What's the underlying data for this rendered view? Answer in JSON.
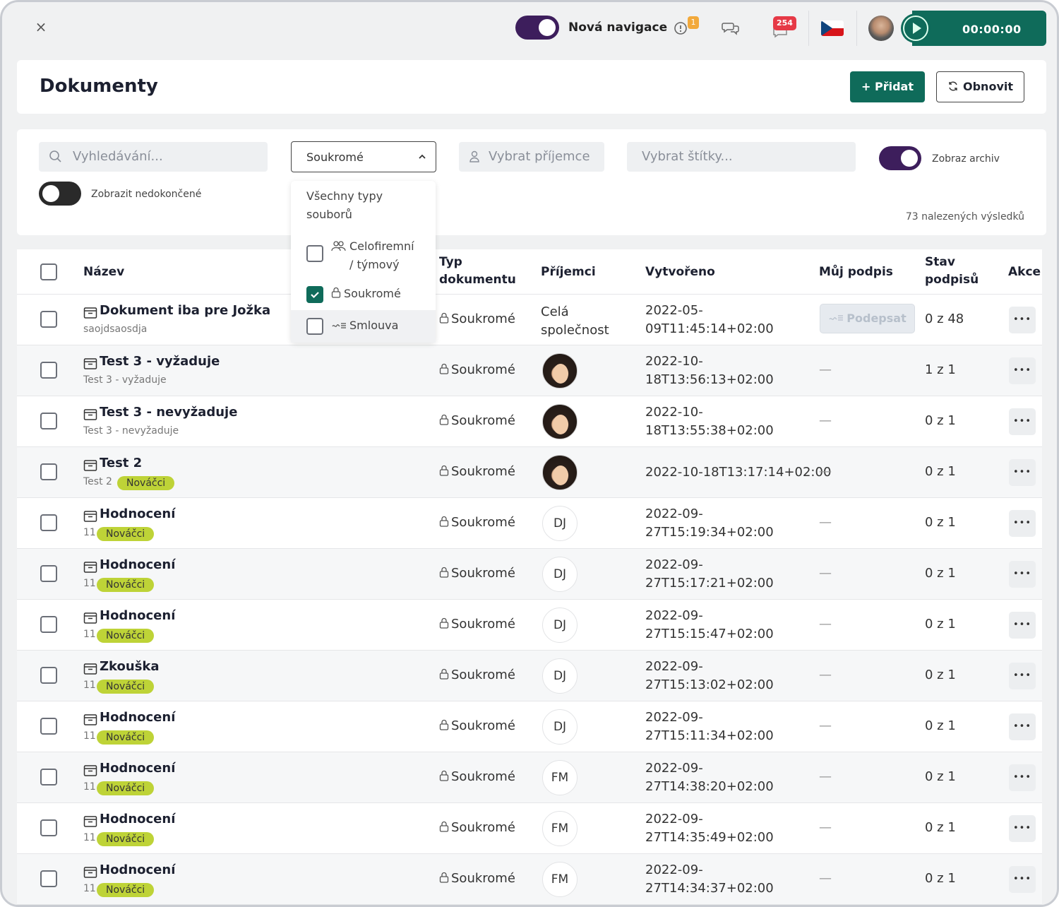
{
  "topbar": {
    "close_icon": "×",
    "nav_toggle_label": "Nová navigace",
    "notification_count": "1",
    "message_count": "254",
    "language": "CZ",
    "timer": "00:00:00"
  },
  "header": {
    "title": "Dokumenty",
    "add_label": "+ Přidat",
    "refresh_label": "Obnovit"
  },
  "filters": {
    "search_placeholder": "Vyhledávání...",
    "type_select_value": "Soukromé",
    "recipient_placeholder": "Vybrat příjemce",
    "tags_placeholder": "Vybrat štítky...",
    "archive_toggle_label": "Zobraz archiv",
    "archive_toggle_on": true,
    "unfinished_toggle_label": "Zobrazit nedokončené",
    "unfinished_toggle_on": false,
    "results_count": "73 nalezených výsledků"
  },
  "type_menu": {
    "all_types_line1": "Všechny typy",
    "all_types_line2": "souborů",
    "options": [
      {
        "label_line1": "Celofiremní",
        "label_line2": "/ týmový",
        "icon": "users-icon",
        "checked": false
      },
      {
        "label": "Soukromé",
        "icon": "lock-icon",
        "checked": true
      },
      {
        "label": "Smlouva",
        "icon": "contract-icon",
        "checked": false
      }
    ]
  },
  "table": {
    "headers": {
      "name": "Název",
      "type_line1": "Typ",
      "type_line2": "dokumentu",
      "recipients": "Příjemci",
      "created": "Vytvořeno",
      "my_signature": "Můj podpis",
      "status_line1": "Stav",
      "status_line2": "podpisů",
      "actions": "Akce"
    },
    "rows": [
      {
        "title": "Dokument iba pre Jožka",
        "subtitle": "saojdsaosdja",
        "tag": "",
        "type": "Soukromé",
        "recipient_line1": "Celá",
        "recipient_line2": "společnost",
        "created_line1": "2022-05-",
        "created_line2": "09T11:45:14+02:00",
        "my_sign": "Podepsat",
        "status": "0 z 48",
        "actions": "•••"
      },
      {
        "title": "Test 3 - vyžaduje",
        "subtitle": "Test 3 - vyžaduje",
        "tag": "",
        "type": "Soukromé",
        "recipient_avatar": "photo-avatar",
        "created_line1": "2022-10-",
        "created_line2": "18T13:56:13+02:00",
        "my_sign": "—",
        "status": "1 z 1",
        "actions": "•••"
      },
      {
        "title": "Test 3 - nevyžaduje",
        "subtitle": "Test 3 - nevyžaduje",
        "tag": "",
        "type": "Soukromé",
        "recipient_avatar": "photo-avatar",
        "created_line1": "2022-10-",
        "created_line2": "18T13:55:38+02:00",
        "my_sign": "—",
        "status": "0 z 1",
        "actions": "•••"
      },
      {
        "title": "Test 2",
        "subtitle": "Test 2",
        "tag": "Nováčci",
        "type": "Soukromé",
        "recipient_avatar": "photo-avatar",
        "created_line1": "2022-10-18T13:17:14+02:00",
        "created_line2": "",
        "my_sign": "—",
        "status": "0 z 1",
        "actions": "•••"
      },
      {
        "title": "Hodnocení",
        "subtitle": "11",
        "tag": "Nováčci",
        "type": "Soukromé",
        "recipient_initials": "DJ",
        "created_line1": "2022-09-",
        "created_line2": "27T15:19:34+02:00",
        "my_sign": "—",
        "status": "0 z 1",
        "actions": "•••"
      },
      {
        "title": "Hodnocení",
        "subtitle": "11",
        "tag": "Nováčci",
        "type": "Soukromé",
        "recipient_initials": "DJ",
        "created_line1": "2022-09-",
        "created_line2": "27T15:17:21+02:00",
        "my_sign": "—",
        "status": "0 z 1",
        "actions": "•••"
      },
      {
        "title": "Hodnocení",
        "subtitle": "11",
        "tag": "Nováčci",
        "type": "Soukromé",
        "recipient_initials": "DJ",
        "created_line1": "2022-09-",
        "created_line2": "27T15:15:47+02:00",
        "my_sign": "—",
        "status": "0 z 1",
        "actions": "•••"
      },
      {
        "title": "Zkouška",
        "subtitle": "11",
        "tag": "Nováčci",
        "type": "Soukromé",
        "recipient_initials": "DJ",
        "created_line1": "2022-09-",
        "created_line2": "27T15:13:02+02:00",
        "my_sign": "—",
        "status": "0 z 1",
        "actions": "•••"
      },
      {
        "title": "Hodnocení",
        "subtitle": "11",
        "tag": "Nováčci",
        "type": "Soukromé",
        "recipient_initials": "DJ",
        "created_line1": "2022-09-",
        "created_line2": "27T15:11:34+02:00",
        "my_sign": "—",
        "status": "0 z 1",
        "actions": "•••"
      },
      {
        "title": "Hodnocení",
        "subtitle": "11",
        "tag": "Nováčci",
        "type": "Soukromé",
        "recipient_initials": "FM",
        "created_line1": "2022-09-",
        "created_line2": "27T14:38:20+02:00",
        "my_sign": "—",
        "status": "0 z 1",
        "actions": "•••"
      },
      {
        "title": "Hodnocení",
        "subtitle": "11",
        "tag": "Nováčci",
        "type": "Soukromé",
        "recipient_initials": "FM",
        "created_line1": "2022-09-",
        "created_line2": "27T14:35:49+02:00",
        "my_sign": "—",
        "status": "0 z 1",
        "actions": "•••"
      },
      {
        "title": "Hodnocení",
        "subtitle": "11",
        "tag": "Nováčci",
        "type": "Soukromé",
        "recipient_initials": "FM",
        "created_line1": "2022-09-",
        "created_line2": "27T14:34:37+02:00",
        "my_sign": "—",
        "status": "0 z 1",
        "actions": "•••"
      }
    ]
  },
  "colors": {
    "brand_green": "#0f6b5a",
    "toggle_purple": "#3d1e5c",
    "tag_lime": "#bed337",
    "badge_red": "#e63946",
    "badge_orange": "#f2a93b"
  }
}
